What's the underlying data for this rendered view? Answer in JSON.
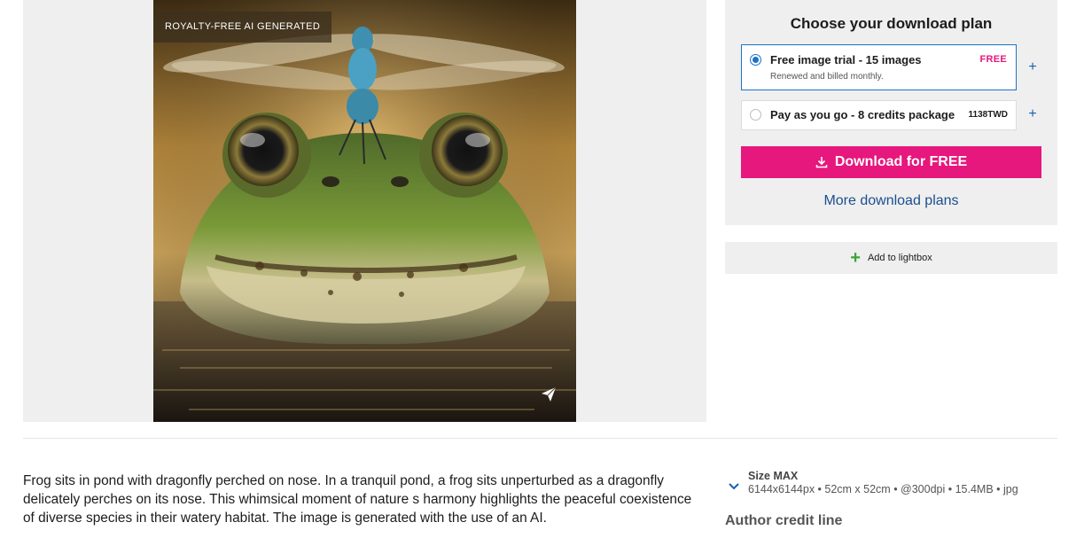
{
  "image": {
    "badge": "ROYALTY-FREE AI GENERATED",
    "share_icon": "share-paper-plane-icon"
  },
  "plans": {
    "heading": "Choose your download plan",
    "options": [
      {
        "title": "Free image trial - 15 images",
        "subtitle": "Renewed and billed monthly.",
        "price": "FREE",
        "selected": true
      },
      {
        "title": "Pay as you go - 8 credits package",
        "price": "1138TWD",
        "selected": false
      }
    ],
    "download_label": "Download for FREE",
    "more_plans_label": "More download plans"
  },
  "lightbox": {
    "label": "Add to lightbox"
  },
  "description": "Frog sits in pond with dragonfly perched on nose. In a tranquil pond, a frog sits unperturbed as a dragonfly delicately perches on its nose. This whimsical moment of nature s harmony highlights the peaceful coexistence of diverse species in their watery habitat. The image is generated with the use of an AI.",
  "size": {
    "title": "Size MAX",
    "details": "6144x6144px • 52cm x 52cm • @300dpi • 15.4MB • jpg"
  },
  "author_credit": {
    "label": "Author credit line"
  },
  "colors": {
    "accent_pink": "#e6177d",
    "link_blue": "#1a4f8f",
    "radio_blue": "#1a73c8",
    "green_plus": "#3aa53a"
  }
}
